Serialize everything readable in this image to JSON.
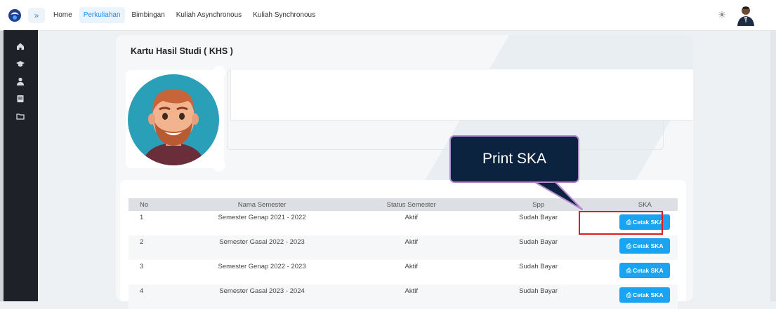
{
  "nav": {
    "items": [
      {
        "label": "Home",
        "active": false
      },
      {
        "label": "Perkuliahan",
        "active": true
      },
      {
        "label": "Bimbingan",
        "active": false
      },
      {
        "label": "Kuliah Asynchronous",
        "active": false
      },
      {
        "label": "Kuliah Synchronous",
        "active": false
      }
    ]
  },
  "sidebar": {
    "icons": [
      "home-icon",
      "graduation-cap-icon",
      "user-tie-icon",
      "book-icon",
      "folder-icon"
    ]
  },
  "card": {
    "title": "Kartu Hasil Studi ( KHS )"
  },
  "table": {
    "headers": [
      "No",
      "Nama Semester",
      "Status Semester",
      "Spp",
      "SKA"
    ],
    "rows": [
      {
        "no": "1",
        "nama": "Semester Genap 2021 - 2022",
        "status": "Aktif",
        "spp": "Sudah Bayar",
        "ska": "Cetak SKA"
      },
      {
        "no": "2",
        "nama": "Semester Gasal 2022 - 2023",
        "status": "Aktif",
        "spp": "Sudah Bayar",
        "ska": "Cetak SKA"
      },
      {
        "no": "3",
        "nama": "Semester Genap 2022 - 2023",
        "status": "Aktif",
        "spp": "Sudah Bayar",
        "ska": "Cetak SKA"
      },
      {
        "no": "4",
        "nama": "Semester Gasal 2023 - 2024",
        "status": "Aktif",
        "spp": "Sudah Bayar",
        "ska": "Cetak SKA"
      }
    ]
  },
  "callout": {
    "text": "Print SKA"
  },
  "colors": {
    "accent": "#1d8cf0",
    "button": "#1aa3f0",
    "sidebar": "#1e2128",
    "callout_bg": "#0c2340",
    "highlight": "#e21b23"
  }
}
